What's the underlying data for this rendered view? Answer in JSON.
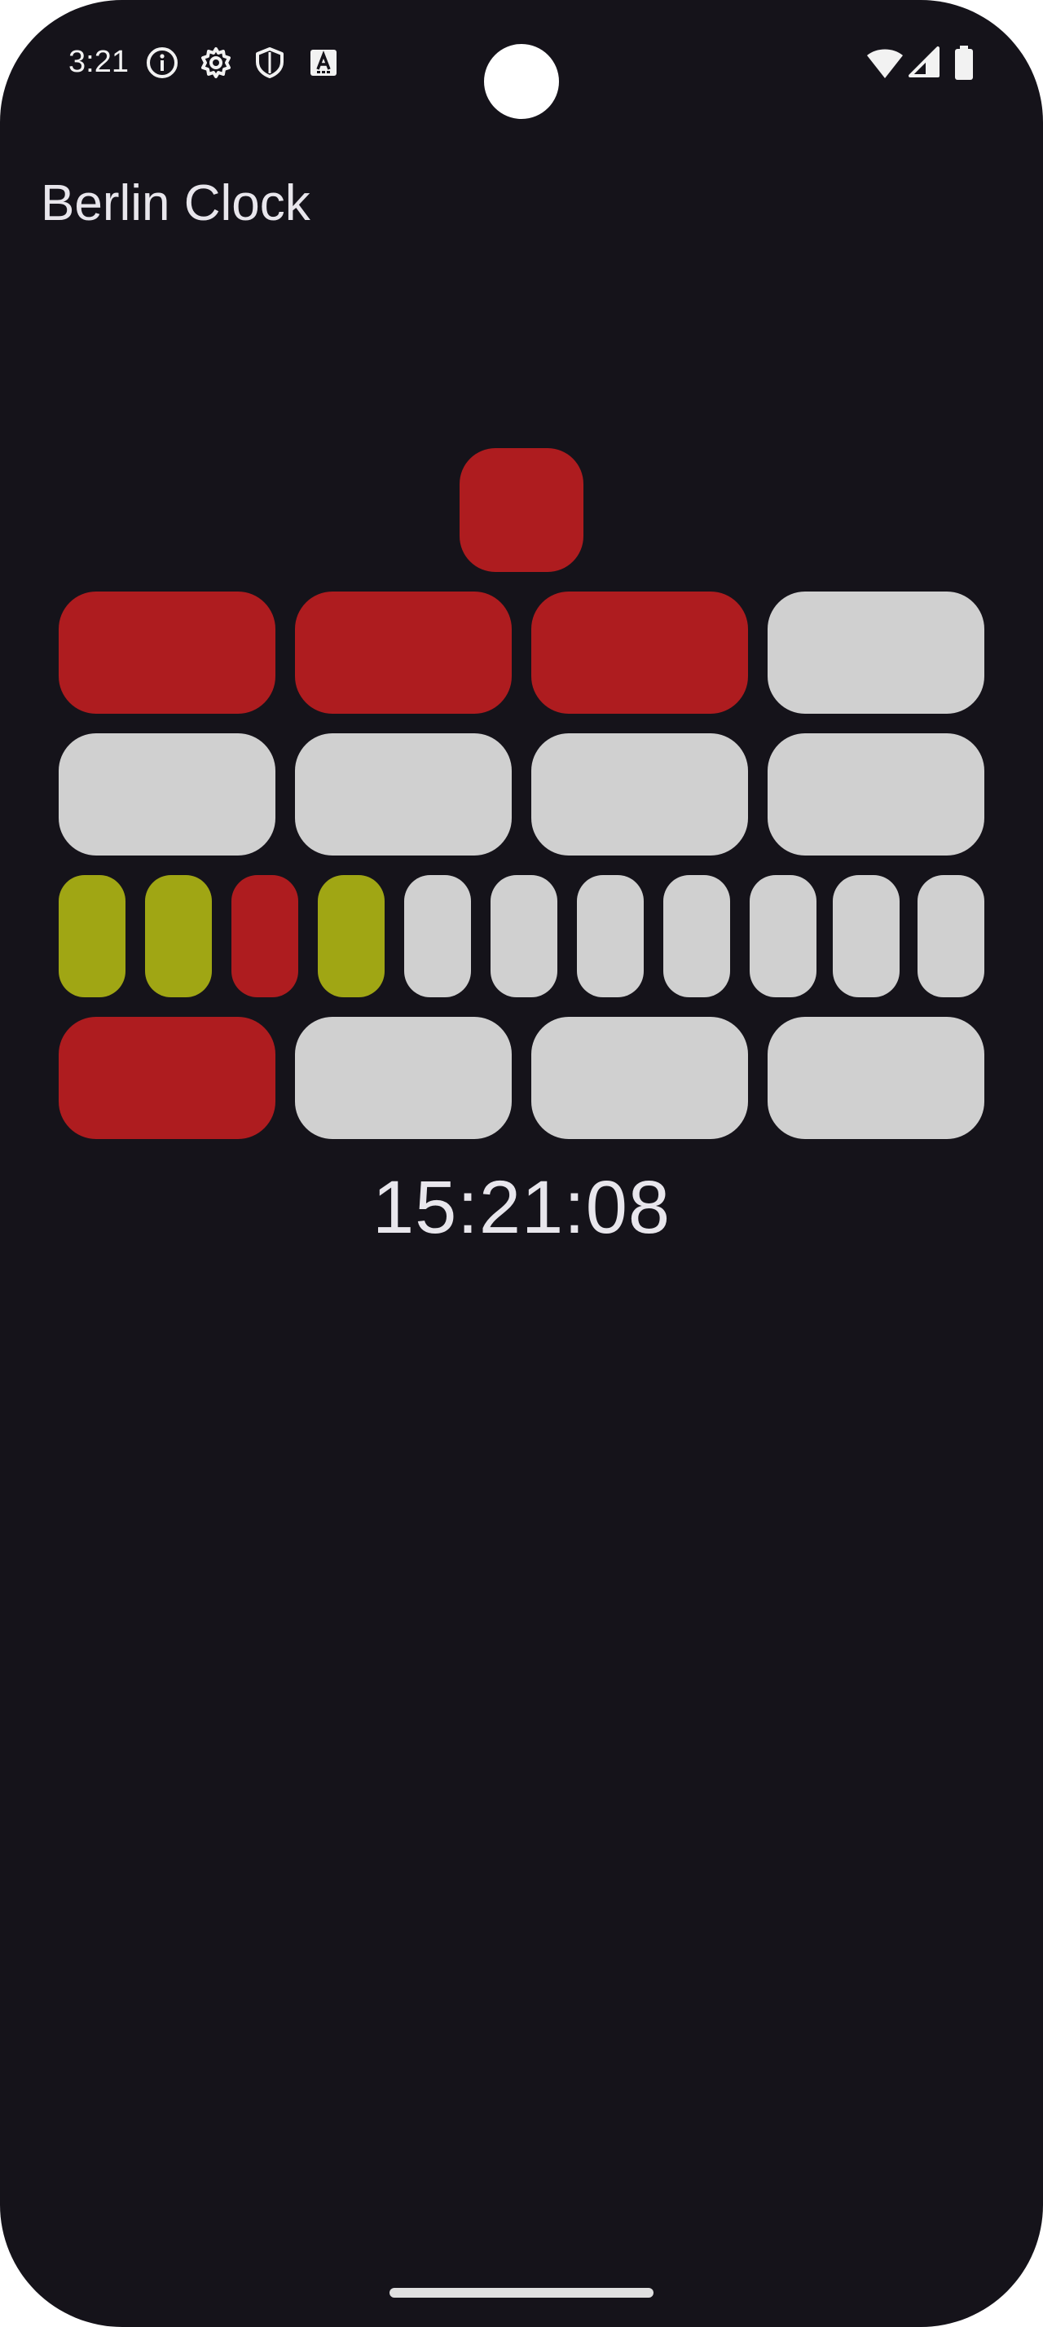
{
  "status_bar": {
    "time": "3:21",
    "left_icons": [
      "info-icon",
      "gear-icon",
      "shield-icon",
      "font-a-icon"
    ],
    "right_icons": [
      "wifi-icon",
      "cell-signal-icon",
      "battery-icon"
    ]
  },
  "app": {
    "title": "Berlin Clock"
  },
  "clock": {
    "digital_time": "15:21:08",
    "colors": {
      "red_on": "#ae1c1f",
      "yellow_on": "#a0a614",
      "off": "#d0d0d0",
      "background": "#15131a"
    },
    "seconds_lamp": "red",
    "five_hours_row": [
      "red",
      "red",
      "red",
      "off"
    ],
    "single_hours_row": [
      "off",
      "off",
      "off",
      "off"
    ],
    "five_minutes_row": [
      "yellow",
      "yellow",
      "red",
      "yellow",
      "off",
      "off",
      "off",
      "off",
      "off",
      "off",
      "off"
    ],
    "single_minutes_row": [
      "red",
      "off",
      "off",
      "off"
    ]
  }
}
